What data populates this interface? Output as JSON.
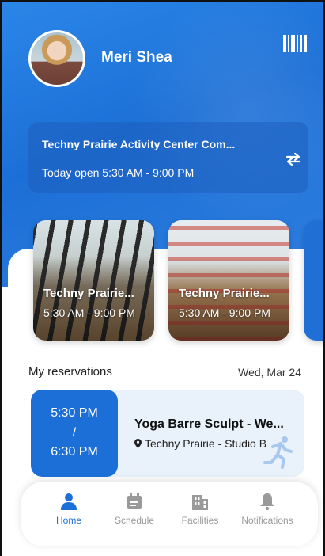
{
  "user": {
    "name": "Meri Shea"
  },
  "facility": {
    "name": "Techny Prairie Activity Center Com...",
    "hours": "Today open 5:30 AM - 9:00 PM"
  },
  "studios": [
    {
      "title": "Techny Prairie...",
      "hours": "5:30 AM - 9:00 PM"
    },
    {
      "title": "Techny Prairie...",
      "hours": "5:30 AM - 9:00 PM"
    }
  ],
  "reservations": {
    "section_title": "My reservations",
    "date": "Wed, Mar 24",
    "items": [
      {
        "start": "5:30 PM",
        "separator": "/",
        "end": "6:30 PM",
        "title": "Yoga Barre Sculpt - We...",
        "location": "Techny Prairie - Studio B"
      }
    ]
  },
  "nav": [
    {
      "label": "Home",
      "icon": "person-icon",
      "active": true
    },
    {
      "label": "Schedule",
      "icon": "calendar-icon",
      "active": false
    },
    {
      "label": "Facilities",
      "icon": "building-icon",
      "active": false
    },
    {
      "label": "Notifications",
      "icon": "bell-icon",
      "active": false
    }
  ],
  "colors": {
    "primary": "#1b6fd6",
    "inactive": "#9a9a9a"
  }
}
